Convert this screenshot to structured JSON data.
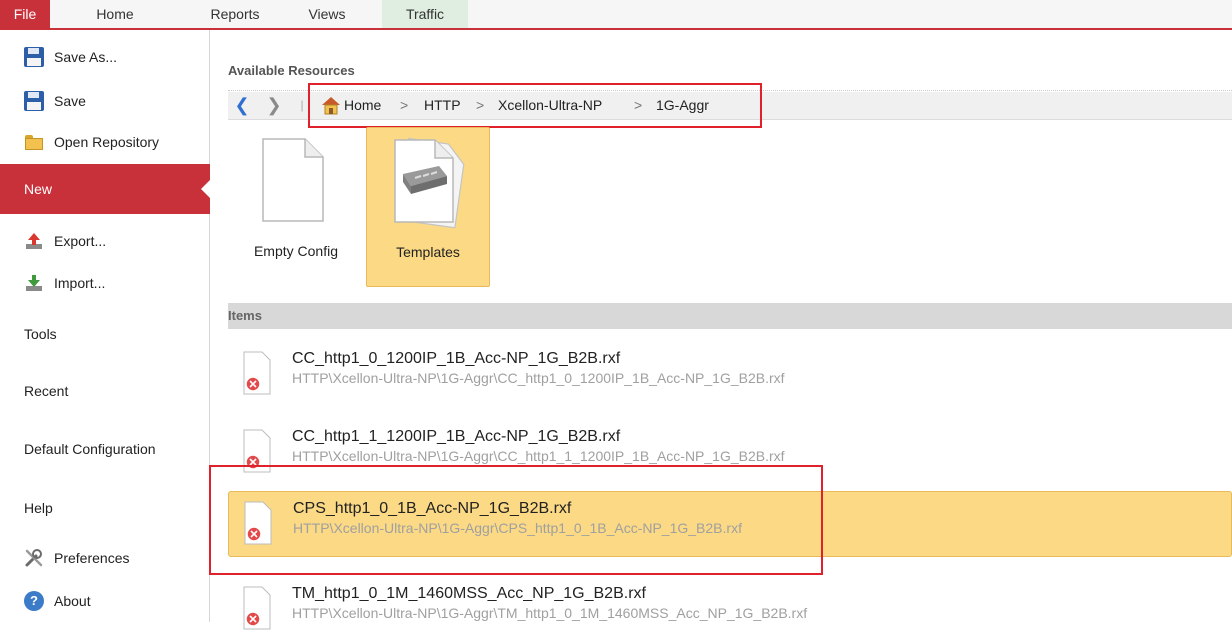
{
  "ribbon": {
    "tabs": [
      {
        "label": "File"
      },
      {
        "label": "Home"
      },
      {
        "label": "Reports"
      },
      {
        "label": "Views"
      },
      {
        "label": "Traffic"
      }
    ]
  },
  "sidebar": {
    "items": [
      {
        "label": "Save As...",
        "icon": "save-as-icon"
      },
      {
        "label": "Save",
        "icon": "save-icon"
      },
      {
        "label": "Open Repository",
        "icon": "folder-icon"
      },
      {
        "label": "New",
        "selected": true
      },
      {
        "label": "Export...",
        "icon": "export-icon"
      },
      {
        "label": "Import...",
        "icon": "import-icon"
      },
      {
        "label": "Tools"
      },
      {
        "label": "Recent"
      },
      {
        "label": "Default Configuration"
      },
      {
        "label": "Help"
      },
      {
        "label": "Preferences",
        "icon": "wrench-icon"
      },
      {
        "label": "About",
        "icon": "about-icon"
      }
    ]
  },
  "main": {
    "resources_label": "Available Resources",
    "breadcrumb": [
      "Home",
      "HTTP",
      "Xcellon-Ultra-NP",
      "1G-Aggr"
    ],
    "separator": ">",
    "tiles": [
      {
        "label": "Empty Config"
      },
      {
        "label": "Templates",
        "selected": true
      }
    ],
    "items_header": "Items",
    "files": [
      {
        "name": "CC_http1_0_1200IP_1B_Acc-NP_1G_B2B.rxf",
        "path": "HTTP\\Xcellon-Ultra-NP\\1G-Aggr\\CC_http1_0_1200IP_1B_Acc-NP_1G_B2B.rxf"
      },
      {
        "name": "CC_http1_1_1200IP_1B_Acc-NP_1G_B2B.rxf",
        "path": "HTTP\\Xcellon-Ultra-NP\\1G-Aggr\\CC_http1_1_1200IP_1B_Acc-NP_1G_B2B.rxf"
      },
      {
        "name": "CPS_http1_0_1B_Acc-NP_1G_B2B.rxf",
        "path": "HTTP\\Xcellon-Ultra-NP\\1G-Aggr\\CPS_http1_0_1B_Acc-NP_1G_B2B.rxf",
        "selected": true
      },
      {
        "name": "TM_http1_0_1M_1460MSS_Acc_NP_1G_B2B.rxf",
        "path": "HTTP\\Xcellon-Ultra-NP\\1G-Aggr\\TM_http1_0_1M_1460MSS_Acc_NP_1G_B2B.rxf"
      }
    ]
  },
  "colors": {
    "accent": "#c8303a",
    "selection": "#fbd985",
    "highlight_box": "#e0202a"
  }
}
